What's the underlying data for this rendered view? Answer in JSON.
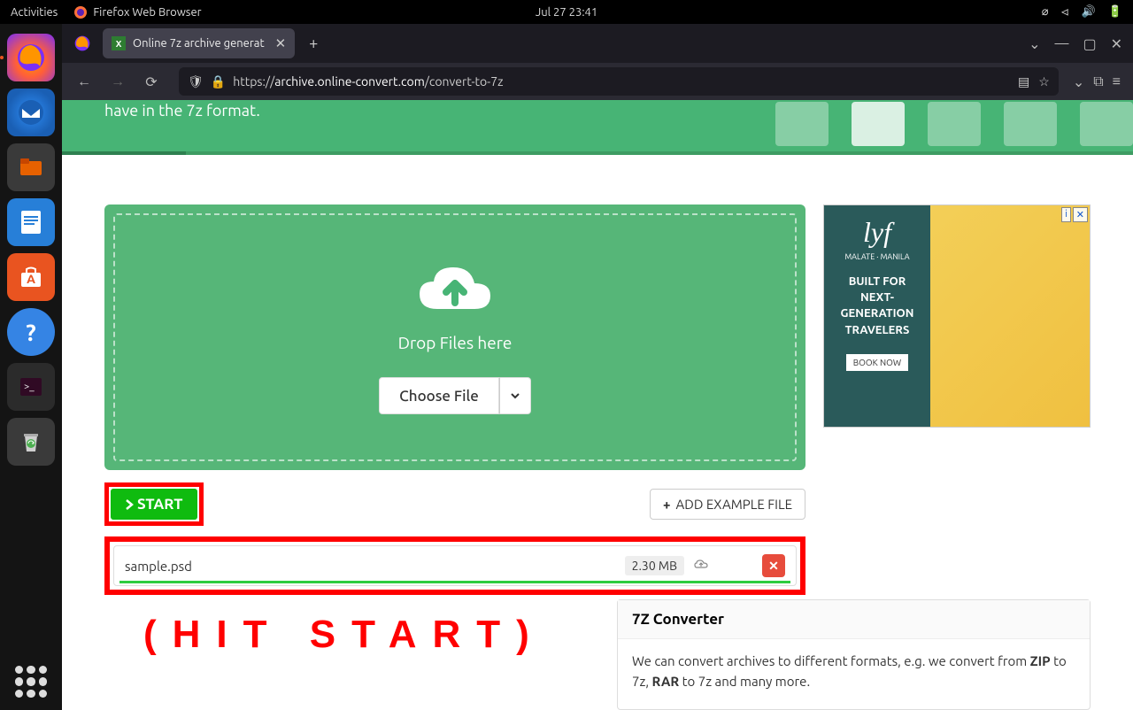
{
  "gnome": {
    "activities": "Activities",
    "app_name": "Firefox Web Browser",
    "clock": "Jul 27  23:41"
  },
  "tab": {
    "title": "Online 7z archive generat"
  },
  "url": {
    "protocol": "https://",
    "domain": "archive.online-convert.com",
    "path": "/convert-to-7z"
  },
  "header": {
    "text": "have in the 7z format."
  },
  "dropzone": {
    "label": "Drop Files here",
    "choose": "Choose File"
  },
  "ad": {
    "logo": "lyf",
    "location": "MALATE · MANILA",
    "headline": "BUILT FOR NEXT-GENERATION TRAVELERS",
    "cta": "BOOK NOW"
  },
  "buttons": {
    "start": "START",
    "add_example": "ADD EXAMPLE FILE"
  },
  "file": {
    "name": "sample.psd",
    "size": "2.30 MB"
  },
  "annotation": "(HIT START)",
  "info": {
    "title": "7Z Converter",
    "body_pre": "We can convert archives to different formats, e.g. we convert from ",
    "zip": "ZIP",
    "body_mid": " to 7z, ",
    "rar": "RAR",
    "body_post": " to 7z and many more."
  }
}
